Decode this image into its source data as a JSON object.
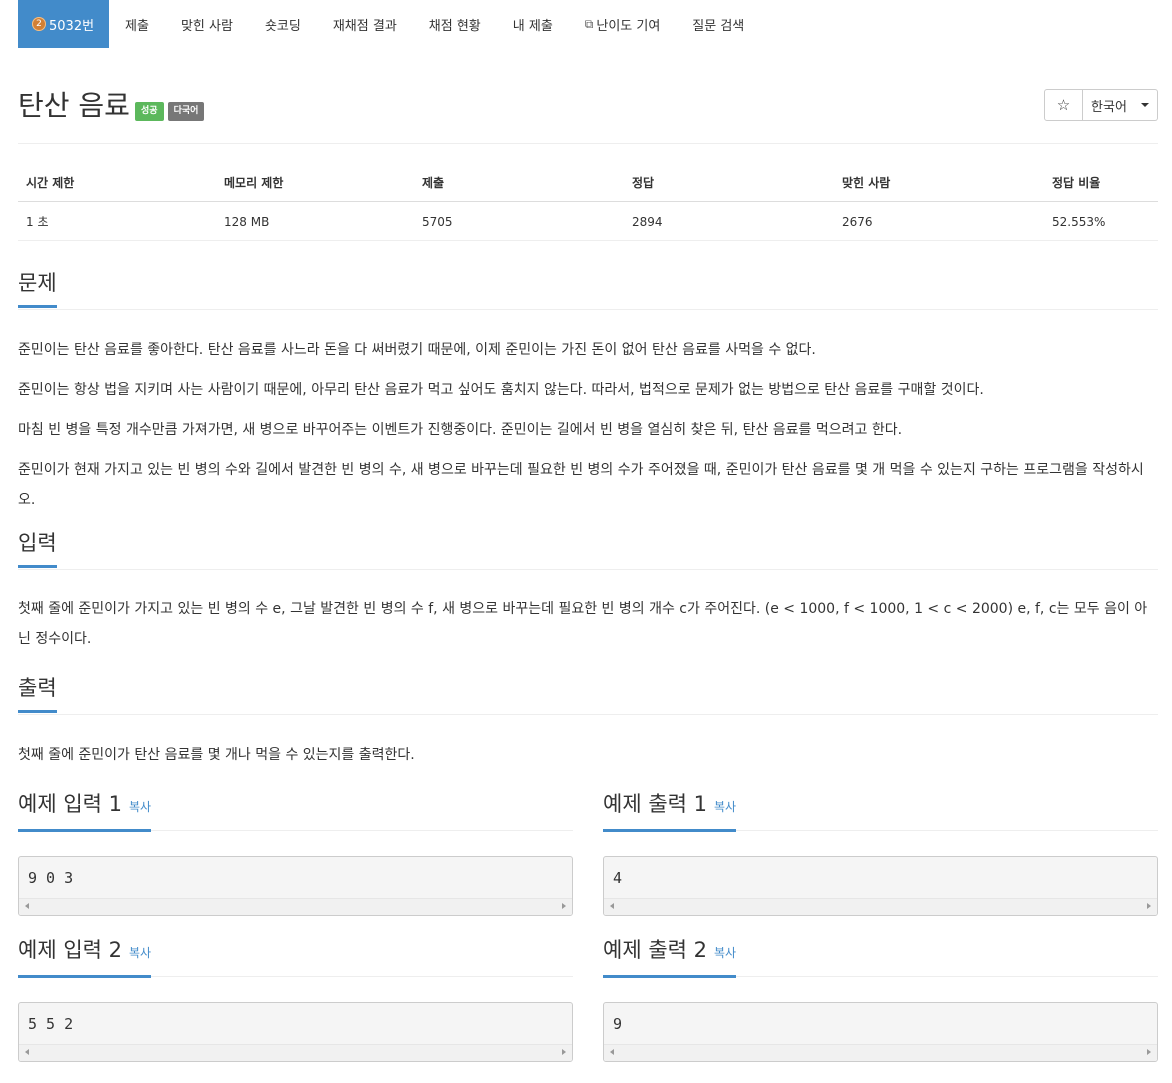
{
  "nav": {
    "tier_badge": "2",
    "problem_tab": "5032번",
    "items": [
      "제출",
      "맞힌 사람",
      "숏코딩",
      "재채점 결과",
      "채점 현황",
      "내 제출",
      "난이도 기여",
      "질문 검색"
    ]
  },
  "problem": {
    "title": "탄산 음료",
    "badge_success": "성공",
    "badge_multilang": "다국어",
    "star": "☆",
    "language": "한국어"
  },
  "info_table": {
    "headers": [
      "시간 제한",
      "메모리 제한",
      "제출",
      "정답",
      "맞힌 사람",
      "정답 비율"
    ],
    "values": [
      "1 초",
      "128 MB",
      "5705",
      "2894",
      "2676",
      "52.553%"
    ]
  },
  "description": {
    "heading": "문제",
    "paragraphs": [
      "준민이는 탄산 음료를 좋아한다. 탄산 음료를 사느라 돈을 다 써버렸기 때문에, 이제 준민이는 가진 돈이 없어 탄산 음료를 사먹을 수 없다.",
      "준민이는 항상 법을 지키며 사는 사람이기 때문에, 아무리 탄산 음료가 먹고 싶어도 훔치지 않는다. 따라서, 법적으로 문제가 없는 방법으로 탄산 음료를 구매할 것이다.",
      "마침 빈 병을 특정 개수만큼 가져가면, 새 병으로 바꾸어주는 이벤트가 진행중이다. 준민이는 길에서 빈 병을 열심히 찾은 뒤, 탄산 음료를 먹으려고 한다.",
      "준민이가 현재 가지고 있는 빈 병의 수와 길에서 발견한 빈 병의 수, 새 병으로 바꾸는데 필요한 빈 병의 수가 주어졌을 때, 준민이가 탄산 음료를 몇 개 먹을 수 있는지 구하는 프로그램을 작성하시오."
    ]
  },
  "input": {
    "heading": "입력",
    "text": "첫째 줄에 준민이가 가지고 있는 빈 병의 수 e, 그날 발견한 빈 병의 수 f, 새 병으로 바꾸는데 필요한 빈 병의 개수 c가 주어진다. (e < 1000, f < 1000, 1 < c < 2000) e, f, c는 모두 음이 아닌 정수이다."
  },
  "output": {
    "heading": "출력",
    "text": "첫째 줄에 준민이가 탄산 음료를 몇 개나 먹을 수 있는지를 출력한다."
  },
  "samples": {
    "copy_label": "복사",
    "input1_title": "예제 입력 1",
    "input1": "9 0 3",
    "output1_title": "예제 출력 1",
    "output1": "4",
    "input2_title": "예제 입력 2",
    "input2": "5 5 2",
    "output2_title": "예제 출력 2",
    "output2": "9"
  }
}
